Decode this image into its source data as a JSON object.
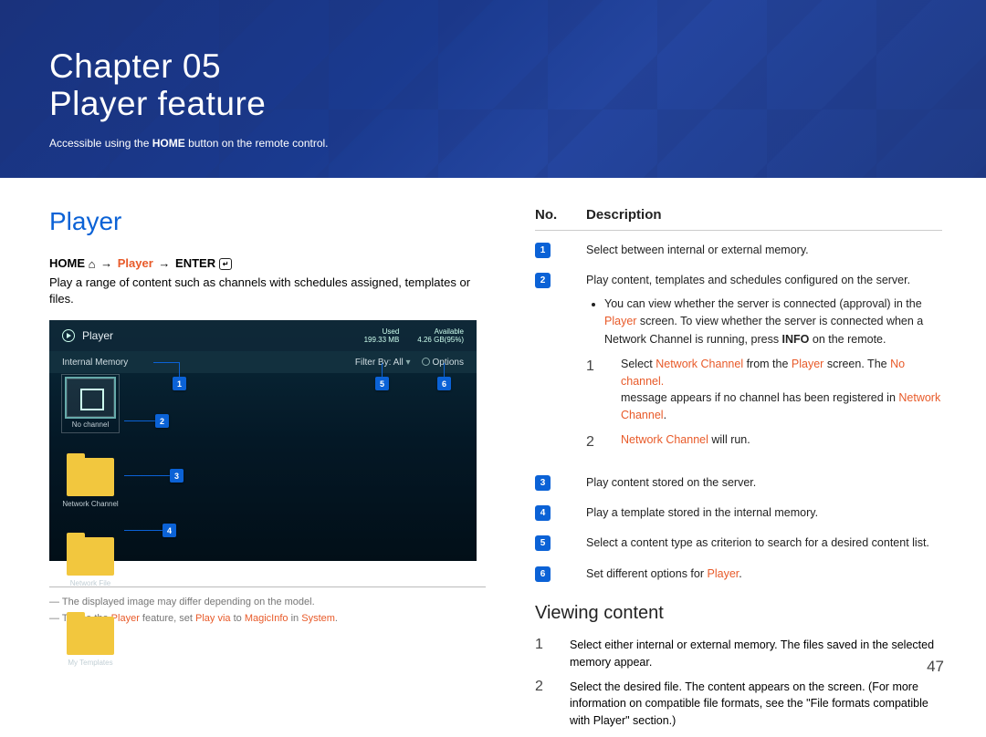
{
  "hero": {
    "chapter": "Chapter  05",
    "title": "Player feature",
    "sub_pre": "Accessible using the ",
    "sub_strong": "HOME",
    "sub_post": " button on the remote control."
  },
  "section_title": "Player",
  "breadcrumb": {
    "home": "HOME",
    "arrow": "→",
    "player": "Player",
    "enter": "ENTER"
  },
  "lead": "Play a range of content such as channels with schedules assigned, templates or files.",
  "shot": {
    "title": "Player",
    "used_label": "Used",
    "used_val": "199.33 MB",
    "avail_label": "Available",
    "avail_val": "4.26 GB(95%)",
    "internal": "Internal Memory",
    "filter": "Filter By: All",
    "options": "Options",
    "cells": [
      {
        "label": "No channel",
        "type": "cal",
        "sel": true
      },
      {
        "label": "Network Channel",
        "type": "folder"
      },
      {
        "label": "Network File",
        "type": "folder"
      },
      {
        "label": "My Templates",
        "type": "folder"
      }
    ],
    "callouts": {
      "c1": "1",
      "c2": "2",
      "c3": "3",
      "c4": "4",
      "c5": "5",
      "c6": "6"
    }
  },
  "foot_note1": "―  The displayed image may differ depending on the model.",
  "foot_note2": {
    "pre": "―  To use the ",
    "a": "Player",
    "mid": " feature, set ",
    "b": "Play via",
    "mid2": " to ",
    "c": "MagicInfo",
    "mid3": " in ",
    "d": "System",
    "post": "."
  },
  "table_head": {
    "no": "No.",
    "desc": "Description"
  },
  "rows": [
    {
      "n": "1",
      "text": "Select between internal or external memory."
    },
    {
      "n": "2",
      "lead": "Play content, templates and schedules configured on the server.",
      "bullet_pre": "You can view whether the server is connected (approval) in the ",
      "bullet_hl": "Player",
      "bullet_mid": " screen. To view whether the server is connected when a Network Channel is running, press ",
      "bullet_strong": "INFO",
      "bullet_post": " on the remote.",
      "sub": [
        {
          "num": "1",
          "pre": "Select ",
          "a": "Network Channel",
          "mid": " from the ",
          "b": "Player",
          "mid2": " screen. The ",
          "c": "No channel.",
          "post": "",
          "line2_pre": "message appears if no channel has been registered in ",
          "line2_hl": "Network Channel",
          "line2_post": "."
        },
        {
          "num": "2",
          "a": "Network Channel",
          "post": " will run."
        }
      ]
    },
    {
      "n": "3",
      "text": "Play content stored on the server."
    },
    {
      "n": "4",
      "text": "Play a template stored in the internal memory."
    },
    {
      "n": "5",
      "text": "Select a content type as criterion to search for a desired content list."
    },
    {
      "n": "6",
      "pre": "Set different options for ",
      "hl": "Player",
      "post": "."
    }
  ],
  "viewing": {
    "title": "Viewing content",
    "items": [
      {
        "num": "1",
        "text": "Select either internal or external memory. The files saved in the selected memory appear."
      },
      {
        "num": "2",
        "text": "Select the desired file. The content appears on the screen. (For more information on compatible file formats, see the \"File formats compatible with Player\" section.)"
      }
    ]
  },
  "page_number": "47"
}
